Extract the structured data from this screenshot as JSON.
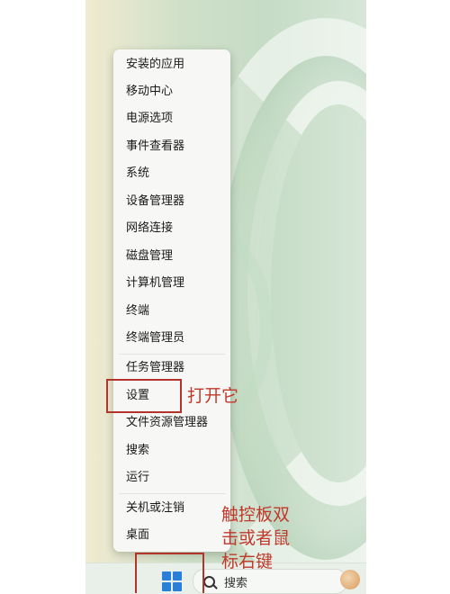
{
  "context_menu": {
    "items": [
      {
        "label": "安装的应用"
      },
      {
        "label": "移动中心"
      },
      {
        "label": "电源选项"
      },
      {
        "label": "事件查看器"
      },
      {
        "label": "系统"
      },
      {
        "label": "设备管理器"
      },
      {
        "label": "网络连接"
      },
      {
        "label": "磁盘管理"
      },
      {
        "label": "计算机管理"
      },
      {
        "label": "终端"
      },
      {
        "label": "终端管理员"
      },
      {
        "label": "任务管理器"
      },
      {
        "label": "设置"
      },
      {
        "label": "文件资源管理器"
      },
      {
        "label": "搜索"
      },
      {
        "label": "运行"
      },
      {
        "label": "关机或注销",
        "submenu": "›"
      },
      {
        "label": "桌面"
      }
    ]
  },
  "annotations": {
    "open_it": "打开它",
    "touch_line1": "触控板双",
    "touch_line2": "击或者鼠",
    "touch_line3": "标右键"
  },
  "taskbar": {
    "search_label": "搜索",
    "start_icon": "windows-logo-icon",
    "widget_icon": "widget-avatar-icon"
  },
  "colors": {
    "annotation_red": "#c0392b",
    "windows_blue": "#2a7fd8"
  }
}
